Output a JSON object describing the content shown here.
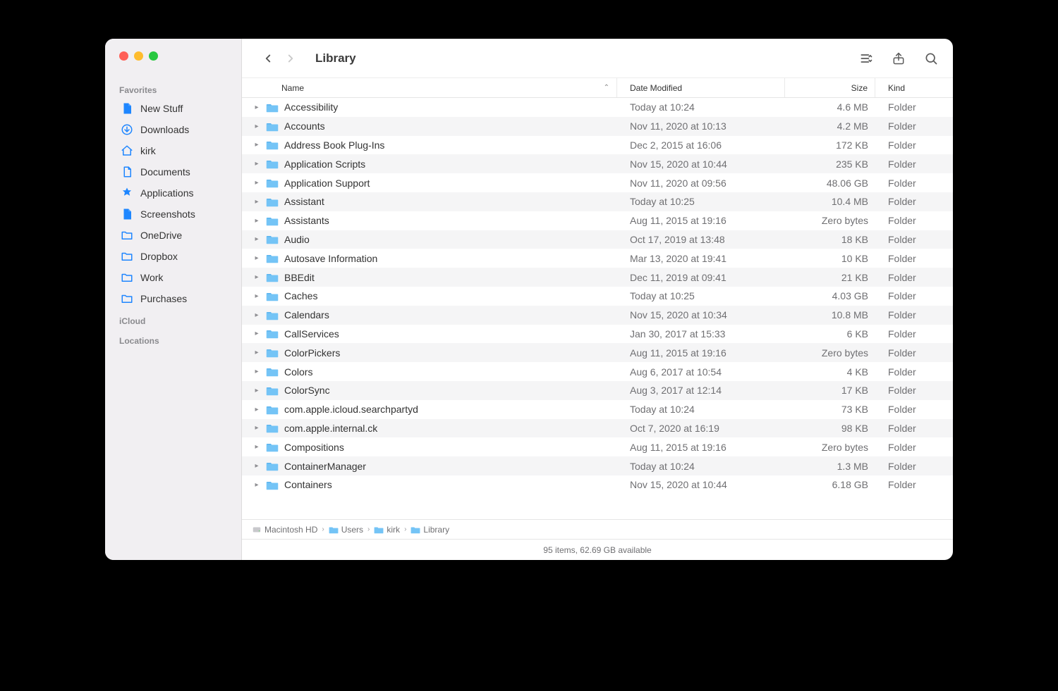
{
  "window_title": "Library",
  "sidebar": {
    "sections": [
      {
        "label": "Favorites",
        "items": [
          {
            "icon": "doc-blue",
            "label": "New Stuff"
          },
          {
            "icon": "download",
            "label": "Downloads"
          },
          {
            "icon": "home",
            "label": "kirk"
          },
          {
            "icon": "doc-outline",
            "label": "Documents"
          },
          {
            "icon": "app",
            "label": "Applications"
          },
          {
            "icon": "doc-blue",
            "label": "Screenshots"
          },
          {
            "icon": "folder",
            "label": "OneDrive"
          },
          {
            "icon": "folder",
            "label": "Dropbox"
          },
          {
            "icon": "folder",
            "label": "Work"
          },
          {
            "icon": "folder",
            "label": "Purchases"
          }
        ]
      },
      {
        "label": "iCloud",
        "items": []
      },
      {
        "label": "Locations",
        "items": []
      }
    ]
  },
  "columns": {
    "name": "Name",
    "date": "Date Modified",
    "size": "Size",
    "kind": "Kind"
  },
  "rows": [
    {
      "name": "Accessibility",
      "date": "Today at 10:24",
      "size": "4.6 MB",
      "kind": "Folder"
    },
    {
      "name": "Accounts",
      "date": "Nov 11, 2020 at 10:13",
      "size": "4.2 MB",
      "kind": "Folder"
    },
    {
      "name": "Address Book Plug-Ins",
      "date": "Dec 2, 2015 at 16:06",
      "size": "172 KB",
      "kind": "Folder"
    },
    {
      "name": "Application Scripts",
      "date": "Nov 15, 2020 at 10:44",
      "size": "235 KB",
      "kind": "Folder"
    },
    {
      "name": "Application Support",
      "date": "Nov 11, 2020 at 09:56",
      "size": "48.06 GB",
      "kind": "Folder"
    },
    {
      "name": "Assistant",
      "date": "Today at 10:25",
      "size": "10.4 MB",
      "kind": "Folder"
    },
    {
      "name": "Assistants",
      "date": "Aug 11, 2015 at 19:16",
      "size": "Zero bytes",
      "kind": "Folder"
    },
    {
      "name": "Audio",
      "date": "Oct 17, 2019 at 13:48",
      "size": "18 KB",
      "kind": "Folder"
    },
    {
      "name": "Autosave Information",
      "date": "Mar 13, 2020 at 19:41",
      "size": "10 KB",
      "kind": "Folder"
    },
    {
      "name": "BBEdit",
      "date": "Dec 11, 2019 at 09:41",
      "size": "21 KB",
      "kind": "Folder"
    },
    {
      "name": "Caches",
      "date": "Today at 10:25",
      "size": "4.03 GB",
      "kind": "Folder"
    },
    {
      "name": "Calendars",
      "date": "Nov 15, 2020 at 10:34",
      "size": "10.8 MB",
      "kind": "Folder"
    },
    {
      "name": "CallServices",
      "date": "Jan 30, 2017 at 15:33",
      "size": "6 KB",
      "kind": "Folder"
    },
    {
      "name": "ColorPickers",
      "date": "Aug 11, 2015 at 19:16",
      "size": "Zero bytes",
      "kind": "Folder"
    },
    {
      "name": "Colors",
      "date": "Aug 6, 2017 at 10:54",
      "size": "4 KB",
      "kind": "Folder"
    },
    {
      "name": "ColorSync",
      "date": "Aug 3, 2017 at 12:14",
      "size": "17 KB",
      "kind": "Folder"
    },
    {
      "name": "com.apple.icloud.searchpartyd",
      "date": "Today at 10:24",
      "size": "73 KB",
      "kind": "Folder"
    },
    {
      "name": "com.apple.internal.ck",
      "date": "Oct 7, 2020 at 16:19",
      "size": "98 KB",
      "kind": "Folder"
    },
    {
      "name": "Compositions",
      "date": "Aug 11, 2015 at 19:16",
      "size": "Zero bytes",
      "kind": "Folder"
    },
    {
      "name": "ContainerManager",
      "date": "Today at 10:24",
      "size": "1.3 MB",
      "kind": "Folder"
    },
    {
      "name": "Containers",
      "date": "Nov 15, 2020 at 10:44",
      "size": "6.18 GB",
      "kind": "Folder"
    }
  ],
  "path": [
    {
      "icon": "disk",
      "label": "Macintosh HD"
    },
    {
      "icon": "folder",
      "label": "Users"
    },
    {
      "icon": "folder",
      "label": "kirk"
    },
    {
      "icon": "folder",
      "label": "Library"
    }
  ],
  "status": "95 items, 62.69 GB available"
}
